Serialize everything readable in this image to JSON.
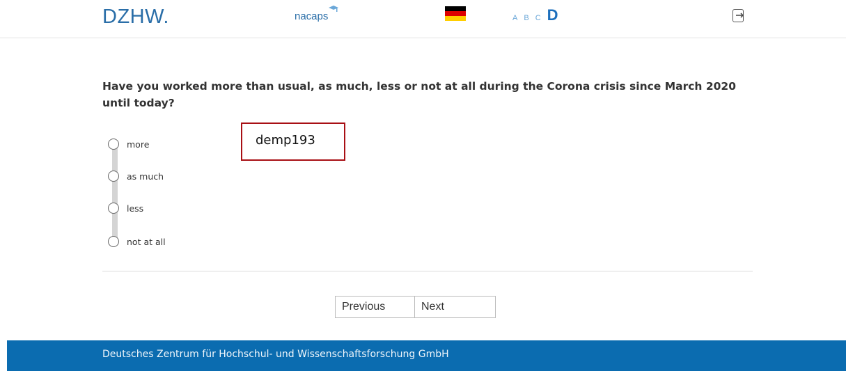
{
  "header": {
    "logo_dzhw": "DZHW.",
    "logo_nacaps": "nacaps",
    "flag_colors": [
      "#000000",
      "#dd0000",
      "#ffce00"
    ],
    "levels": [
      "A",
      "B",
      "C",
      "D"
    ],
    "active_level": "D",
    "exit_icon": "exit-icon"
  },
  "question": {
    "text": "Have you worked more than usual, as much, less or not at all during the Corona crisis since March 2020 until today?",
    "options": [
      "more",
      "as much",
      "less",
      "not at all"
    ],
    "selected": null
  },
  "variable_label": "demp193",
  "nav": {
    "previous_label": "Previous",
    "next_label": "Next"
  },
  "footer": {
    "text": "Deutsches Zentrum für Hochschul- und Wissenschaftsforschung GmbH"
  },
  "colors": {
    "brand_blue": "#0b6cb0",
    "annotation_red": "#a80f14"
  }
}
